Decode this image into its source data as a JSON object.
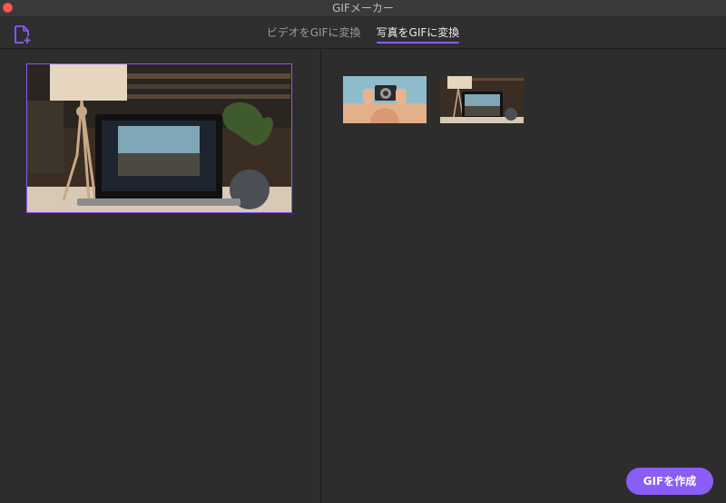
{
  "window": {
    "title": "GIFメーカー"
  },
  "header": {
    "add_icon": "add-file-icon",
    "tabs": [
      {
        "label": "ビデオをGIFに変換",
        "active": false
      },
      {
        "label": "写真をGIFに変換",
        "active": true
      }
    ]
  },
  "left_pane": {
    "preview_image": "laptop-desk-photo"
  },
  "right_pane": {
    "thumbnails": [
      "camera-photo",
      "laptop-desk-photo"
    ]
  },
  "footer": {
    "create_label": "GIFを作成"
  },
  "colors": {
    "accent": "#8b5cf6",
    "background": "#2b2b2b",
    "close": "#fc5c54"
  }
}
